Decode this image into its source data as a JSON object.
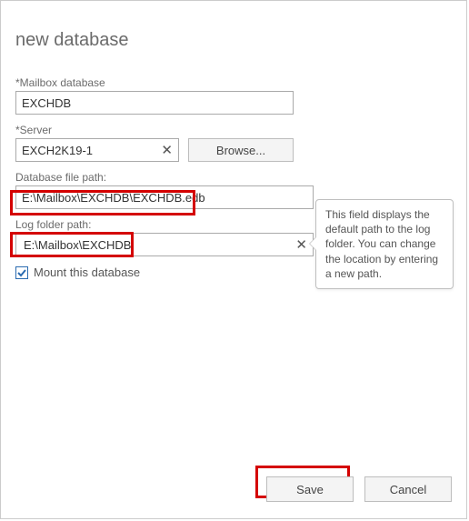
{
  "dialog": {
    "title": "new database",
    "mailbox_label": "*Mailbox database",
    "mailbox_value": "EXCHDB",
    "server_label": "*Server",
    "server_value": "EXCH2K19-1",
    "browse_label": "Browse...",
    "db_path_label": "Database file path:",
    "db_path_value": "E:\\Mailbox\\EXCHDB\\EXCHDB.edb",
    "log_path_label": "Log folder path:",
    "log_path_value": "E:\\Mailbox\\EXCHDB",
    "mount_label": "Mount this database",
    "mount_checked": true
  },
  "tooltip": {
    "text": "This field displays the default path to the log folder. You can change the location by entering a new path."
  },
  "footer": {
    "save": "Save",
    "cancel": "Cancel"
  }
}
